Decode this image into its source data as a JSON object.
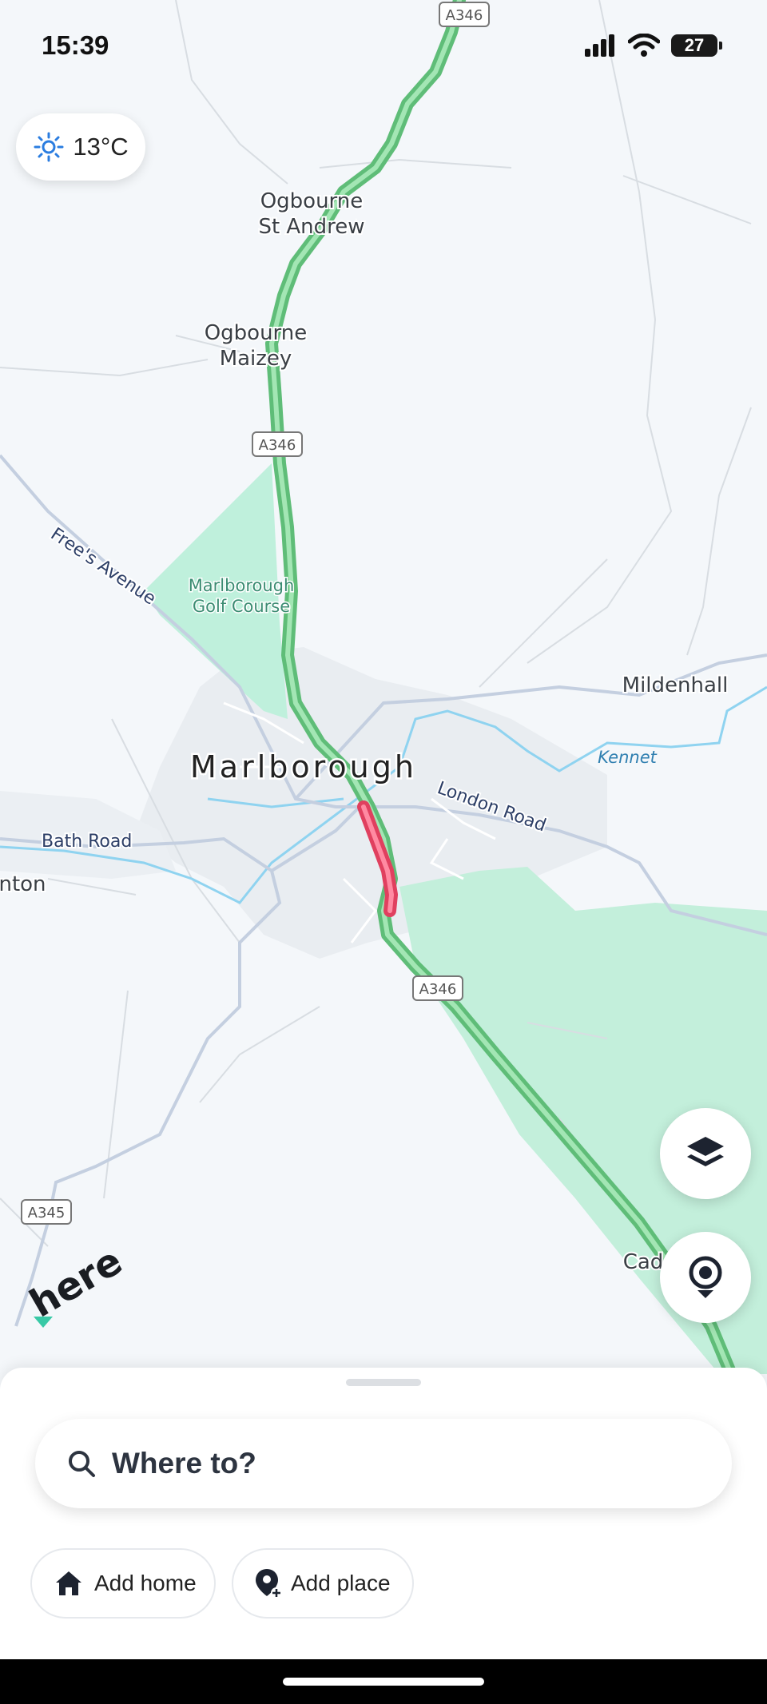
{
  "status_bar": {
    "time": "15:39",
    "battery": "27"
  },
  "weather": {
    "temperature": "13°C",
    "icon": "sun-icon"
  },
  "map": {
    "places": {
      "ogbourne_st_andrew_1": "Ogbourne",
      "ogbourne_st_andrew_2": "St Andrew",
      "ogbourne_maizey_1": "Ogbourne",
      "ogbourne_maizey_2": "Maizey",
      "golf_1": "Marlborough",
      "golf_2": "Golf Course",
      "town": "Marlborough",
      "mildenhall": "Mildenhall",
      "kennet": "Kennet",
      "nton": "nton",
      "cad": "Cad"
    },
    "roads": {
      "frees_avenue": "Free's Avenue",
      "london_road": "London Road",
      "bath_road": "Bath Road"
    },
    "shields": {
      "a346_top": "A346",
      "a346_mid": "A346",
      "a346_low": "A346",
      "a345": "A345"
    },
    "logo": "here",
    "colors": {
      "traffic_free": "#6fd08a",
      "traffic_jam": "#ff5a7a",
      "green_area": "#bff0dc",
      "water": "#8fd3f0"
    }
  },
  "controls": {
    "layers_icon": "layers-icon",
    "locate_icon": "location-pin-icon"
  },
  "bottom_sheet": {
    "search": {
      "placeholder": "Where to?"
    },
    "chips": {
      "home": "Add home",
      "place": "Add place"
    }
  }
}
